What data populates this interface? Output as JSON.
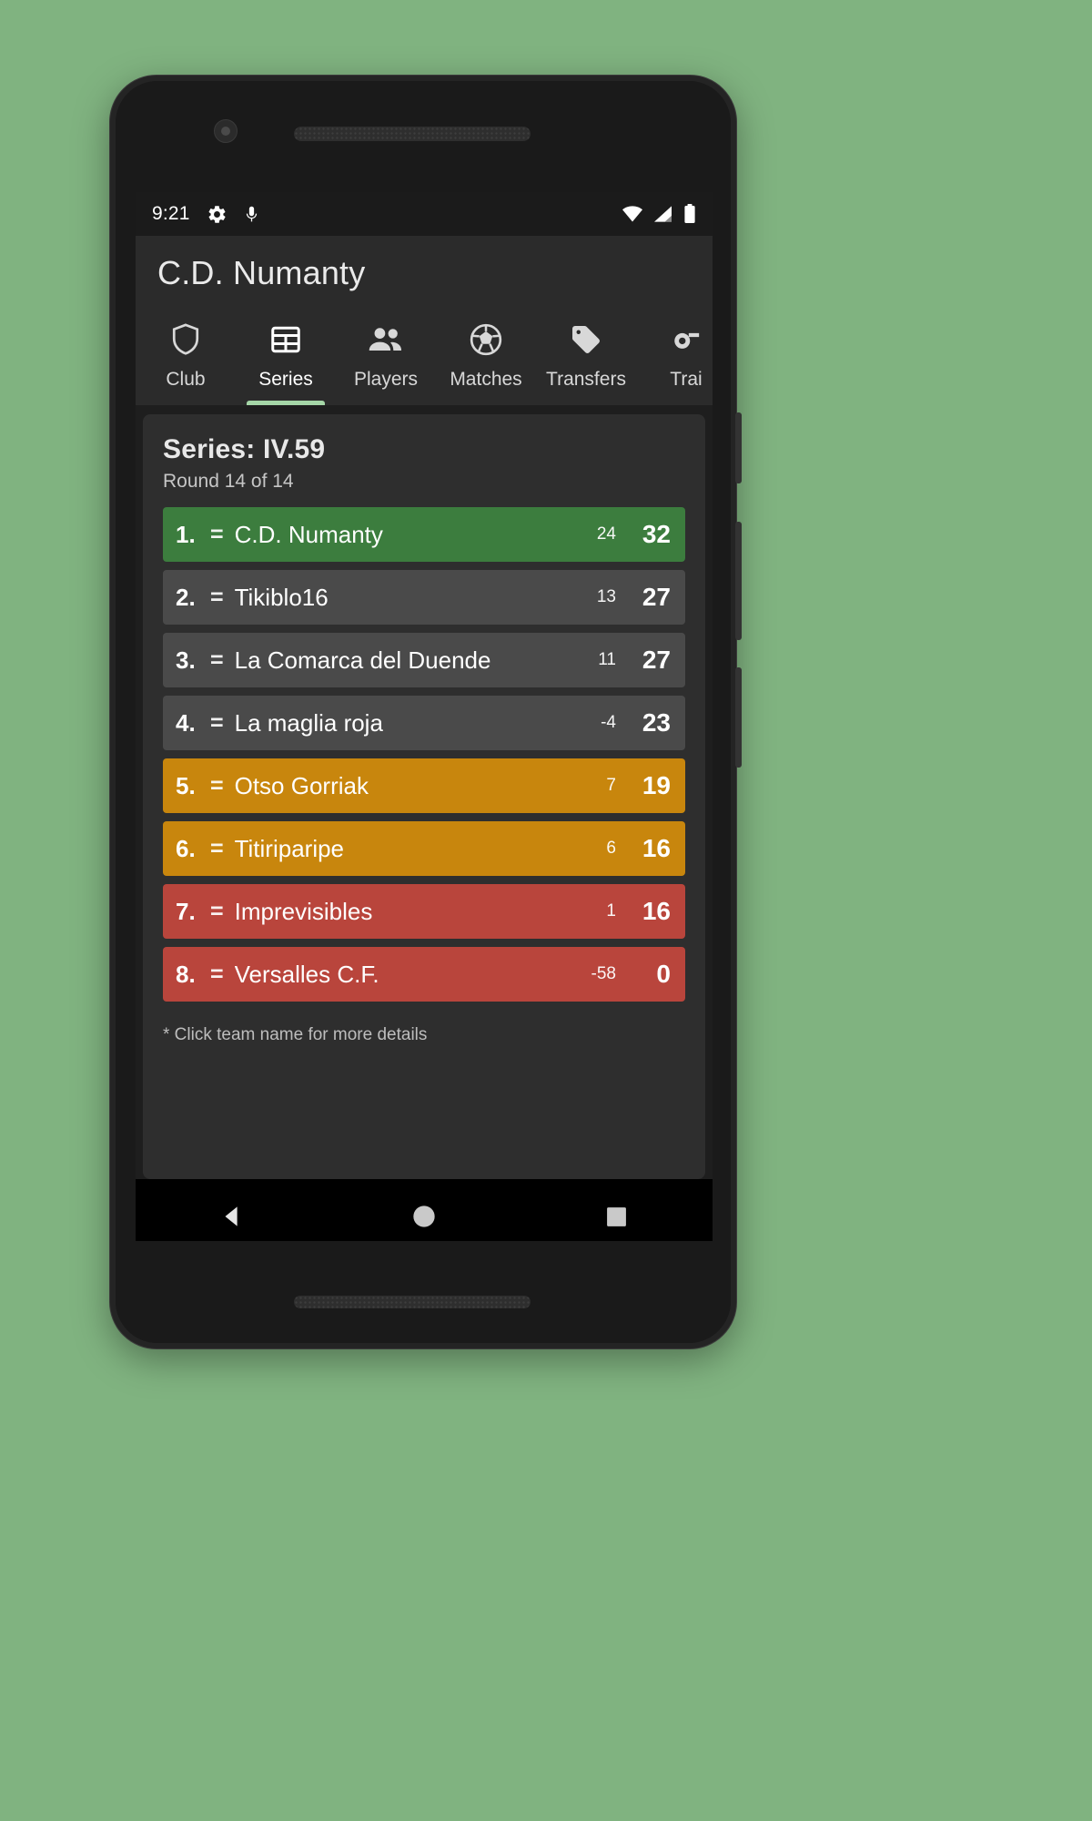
{
  "statusbar": {
    "time": "9:21",
    "left_icons": [
      "gear-icon",
      "microphone-icon"
    ],
    "right_icons": [
      "wifi-icon",
      "cellular-signal-icon",
      "battery-icon"
    ]
  },
  "appbar": {
    "title": "C.D. Numanty"
  },
  "tabs": [
    {
      "label": "Club",
      "icon": "shield-icon",
      "active": false
    },
    {
      "label": "Series",
      "icon": "table-grid-icon",
      "active": true
    },
    {
      "label": "Players",
      "icon": "people-icon",
      "active": false
    },
    {
      "label": "Matches",
      "icon": "soccer-ball-icon",
      "active": false
    },
    {
      "label": "Transfers",
      "icon": "tag-icon",
      "active": false
    },
    {
      "label": "Trai",
      "icon": "whistle-icon",
      "active": false
    }
  ],
  "card": {
    "series_title": "Series: IV.59",
    "round_label": "Round 14 of 14",
    "footnote": "* Click team name for more details",
    "standings": [
      {
        "pos": "1.",
        "move": "=",
        "team": "C.D. Numanty",
        "diff": "24",
        "points": "32",
        "color": "#3c7d3e"
      },
      {
        "pos": "2.",
        "move": "=",
        "team": "Tikiblo16",
        "diff": "13",
        "points": "27",
        "color": "#4a4a4a"
      },
      {
        "pos": "3.",
        "move": "=",
        "team": "La Comarca del Duende",
        "diff": "11",
        "points": "27",
        "color": "#4a4a4a"
      },
      {
        "pos": "4.",
        "move": "=",
        "team": "La maglia roja",
        "diff": "-4",
        "points": "23",
        "color": "#4a4a4a"
      },
      {
        "pos": "5.",
        "move": "=",
        "team": "Otso Gorriak",
        "diff": "7",
        "points": "19",
        "color": "#c8860d"
      },
      {
        "pos": "6.",
        "move": "=",
        "team": "Titiriparipe",
        "diff": "6",
        "points": "16",
        "color": "#c8860d"
      },
      {
        "pos": "7.",
        "move": "=",
        "team": "Imprevisibles",
        "diff": "1",
        "points": "16",
        "color": "#b9453c"
      },
      {
        "pos": "8.",
        "move": "=",
        "team": "Versalles C.F.",
        "diff": "-58",
        "points": "0",
        "color": "#b9453c"
      }
    ]
  },
  "navbar": {
    "buttons": [
      "back-button",
      "home-button",
      "recents-button"
    ]
  },
  "colors": {
    "background": "#80b380",
    "accent_green": "#a5d6a7",
    "promotion_green": "#3c7d3e",
    "neutral_gray": "#4a4a4a",
    "warning_orange": "#c8860d",
    "relegation_red": "#b9453c"
  }
}
